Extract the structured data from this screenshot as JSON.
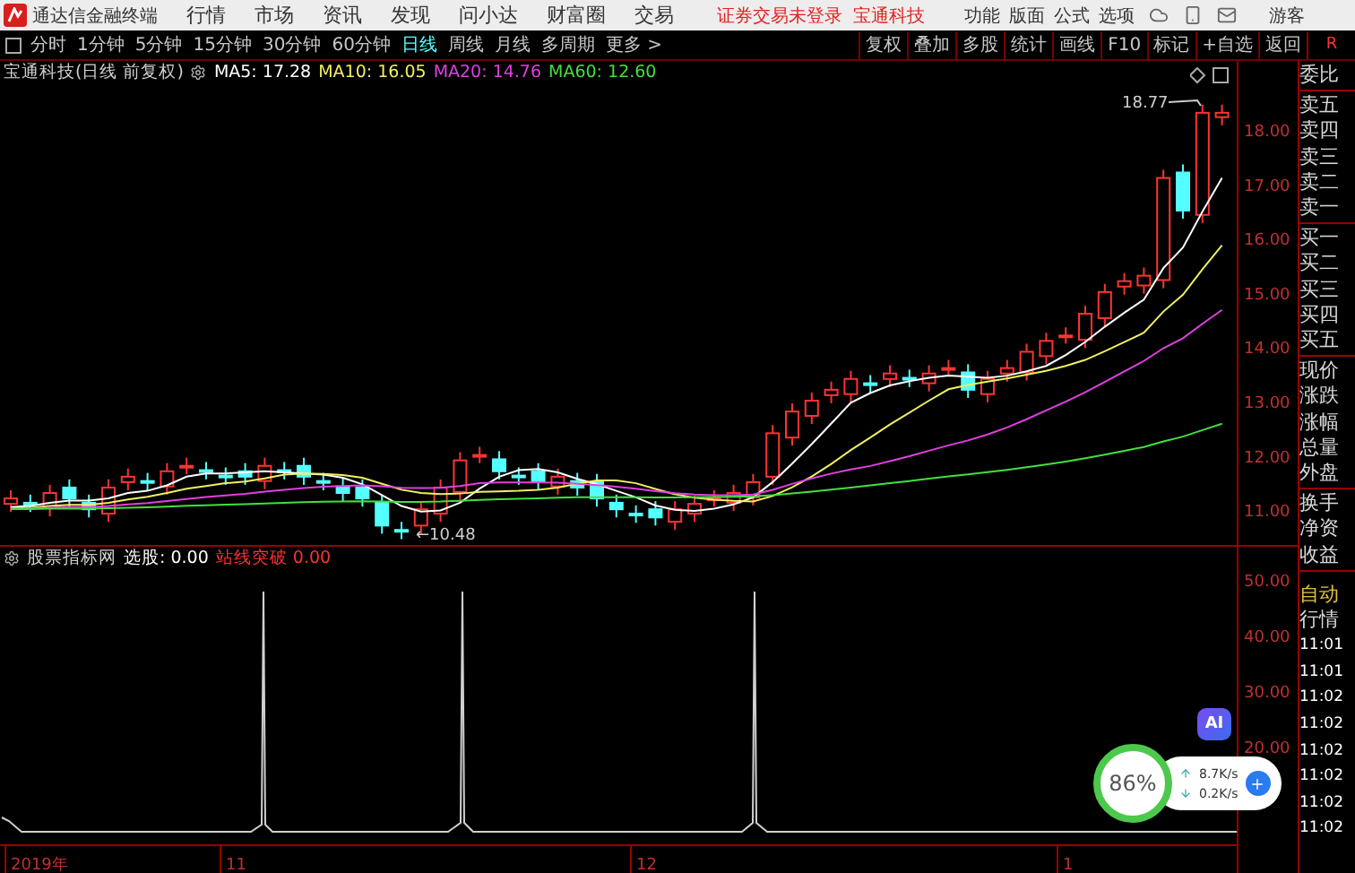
{
  "top_bar": {
    "app_title": "通达信金融终端",
    "menus": [
      "行情",
      "市场",
      "资讯",
      "发现",
      "问小达",
      "财富圈",
      "交易"
    ],
    "notice": "证券交易未登录",
    "stock": "宝通科技",
    "tools": [
      "功能",
      "版面",
      "公式",
      "选项"
    ],
    "user": "游客"
  },
  "toolbar": {
    "periods": [
      {
        "label": "分时",
        "selected": false
      },
      {
        "label": "1分钟",
        "selected": false
      },
      {
        "label": "5分钟",
        "selected": false
      },
      {
        "label": "15分钟",
        "selected": false
      },
      {
        "label": "30分钟",
        "selected": false
      },
      {
        "label": "60分钟",
        "selected": false
      },
      {
        "label": "日线",
        "selected": true
      },
      {
        "label": "周线",
        "selected": false
      },
      {
        "label": "月线",
        "selected": false
      },
      {
        "label": "多周期",
        "selected": false
      }
    ],
    "more": "更多 >",
    "actions": [
      "复权",
      "叠加",
      "多股",
      "统计",
      "画线",
      "F10",
      "标记",
      "+自选",
      "返回"
    ],
    "panel_tag": "R"
  },
  "chart": {
    "title": "宝通科技(日线 前复权)",
    "moving_averages": [
      {
        "label": "MA5: 17.28",
        "color": "#ffffff"
      },
      {
        "label": "MA10: 16.05",
        "color": "#f0f060"
      },
      {
        "label": "MA20: 14.76",
        "color": "#e040e0"
      },
      {
        "label": "MA60: 12.60",
        "color": "#40e040"
      }
    ],
    "high_label": "18.77",
    "low_label": "←10.48",
    "price_ticks": [
      "18.00",
      "17.00",
      "16.00",
      "15.00",
      "14.00",
      "13.00",
      "12.00",
      "11.00"
    ]
  },
  "indicator": {
    "name": "股票指标网",
    "readings": [
      {
        "label": "选股: 0.00",
        "color": "#ffffff"
      },
      {
        "label": "站线突破 0.00",
        "color": "#ff3030"
      }
    ],
    "ticks": [
      "50.00",
      "40.00",
      "30.00",
      "20.00"
    ]
  },
  "date_axis": [
    "2019年",
    "11",
    "12",
    "1"
  ],
  "quote_panel": {
    "groups": [
      [
        "委比"
      ],
      [
        "卖五",
        "卖四",
        "卖三",
        "卖二",
        "卖一"
      ],
      [
        "买一",
        "买二",
        "买三",
        "买四",
        "买五"
      ],
      [
        "现价",
        "涨跌",
        "涨幅",
        "总量",
        "外盘"
      ],
      [
        "换手",
        "净资",
        "收益"
      ]
    ],
    "mode": "自动",
    "section": "行情",
    "times": [
      "11:01",
      "11:01",
      "11:02",
      "11:02",
      "11:02",
      "11:02",
      "11:02",
      "11:02"
    ]
  },
  "speed_widget": {
    "percent": "86%",
    "upload": "8.7K/s",
    "download": "0.2K/s"
  },
  "ai_badge": "AI"
}
